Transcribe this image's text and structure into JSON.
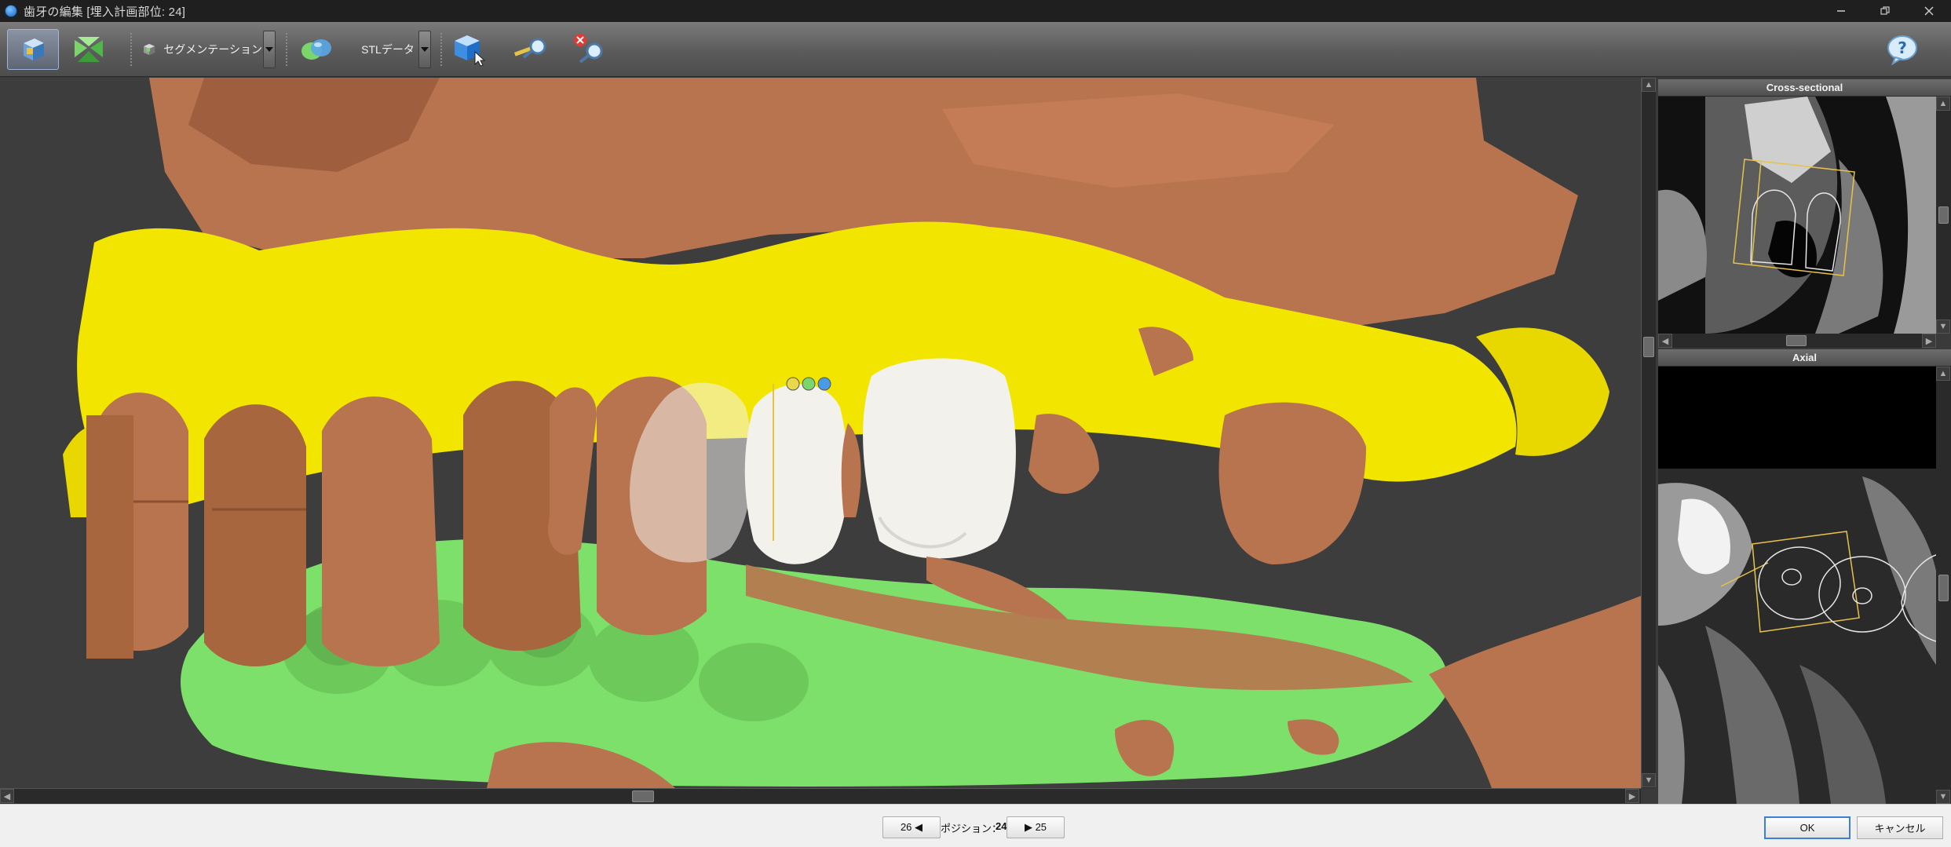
{
  "window": {
    "title": "歯牙の編集 [埋入計画部位: 24]",
    "controls": [
      "minimize-icon",
      "restore-icon",
      "close-icon"
    ]
  },
  "toolbar": {
    "segmentation_label": "セグメンテーション",
    "stl_label": "STLデータ",
    "icons": [
      "view-3d-icon",
      "crosshair-view-icon",
      "segmentation-cube-icon",
      "merge-spheres-icon",
      "cube-pointer-icon",
      "magnify-tool-icon",
      "delete-magnify-icon",
      "help-icon"
    ]
  },
  "panels": {
    "cross_sectional_title": "Cross-sectional",
    "axial_title": "Axial"
  },
  "bottom": {
    "prev_button": "26 ◀",
    "position_label": "ポジション：",
    "position_value": "24",
    "next_button": "▶ 25",
    "ok_button": "OK",
    "cancel_button": "キャンセル"
  },
  "colors": {
    "bone": "#b8744f",
    "upper_model": "#f2e600",
    "lower_model": "#7de06a",
    "crown": "#f2f1ec",
    "background": "#3d3d3d"
  }
}
